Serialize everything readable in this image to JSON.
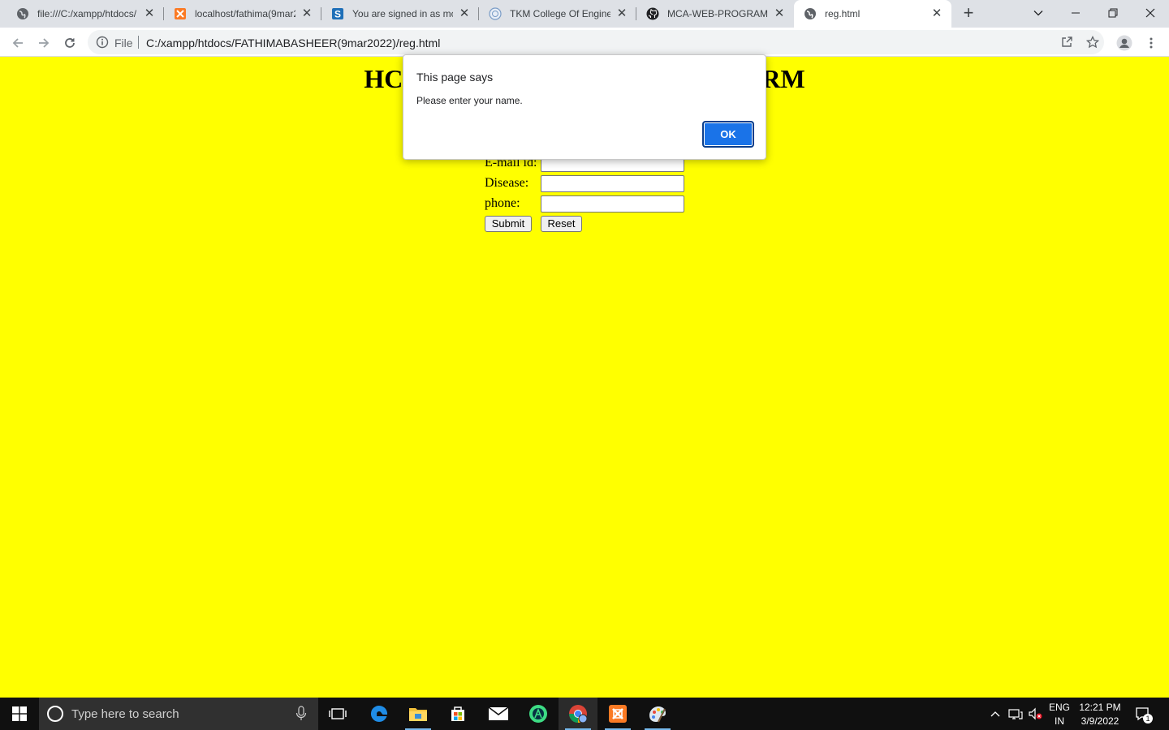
{
  "browser": {
    "tabs": [
      {
        "title": "file:///C:/xampp/htdocs/",
        "favicon": "globe-icon",
        "active": false
      },
      {
        "title": "localhost/fathima(9mar2",
        "favicon": "xampp-icon",
        "active": false
      },
      {
        "title": "You are signed in as mca",
        "favicon": "s-icon",
        "active": false
      },
      {
        "title": "TKM College Of Enginee",
        "favicon": "college-seal-icon",
        "active": false
      },
      {
        "title": "MCA-WEB-PROGRAMM",
        "favicon": "github-icon",
        "active": false
      },
      {
        "title": "reg.html",
        "favicon": "globe-icon",
        "active": true
      }
    ],
    "address": {
      "scheme_label": "File",
      "url": "C:/xampp/htdocs/FATHIMABASHEER(9mar2022)/reg.html"
    }
  },
  "page": {
    "heading_left": "HC",
    "heading_right": "RM",
    "form": {
      "email_label": "E-mail id:",
      "disease_label": "Disease:",
      "phone_label": "phone:",
      "submit_label": "Submit",
      "reset_label": "Reset"
    },
    "background_color": "#ffff00"
  },
  "dialog": {
    "title": "This page says",
    "message": "Please enter your name.",
    "ok_label": "OK",
    "accent_color": "#1a73e8"
  },
  "taskbar": {
    "search_placeholder": "Type here to search",
    "lang_top": "ENG",
    "lang_bottom": "IN",
    "time": "12:21 PM",
    "date": "3/9/2022",
    "notification_count": "1"
  }
}
